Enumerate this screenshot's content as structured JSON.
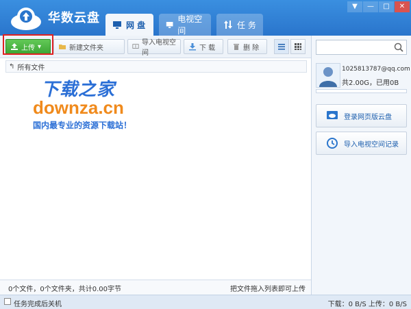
{
  "app": {
    "title": "华数云盘"
  },
  "tabs": [
    {
      "label": "网 盘",
      "active": true
    },
    {
      "label": "电视空间",
      "active": false
    },
    {
      "label": "任 务",
      "active": false
    }
  ],
  "window_buttons": {
    "menu": "▼",
    "minimize": "—",
    "maximize": "□",
    "close": "✕"
  },
  "toolbar": {
    "upload": "上传",
    "new_folder": "新建文件夹",
    "import_tv": "导入电视空间",
    "download": "下 载",
    "delete": "删 除"
  },
  "breadcrumb": {
    "label": "所有文件"
  },
  "watermark": {
    "line1": "下载之家",
    "line2": "downza.cn",
    "line3": "国内最专业的资源下载站！"
  },
  "status": {
    "summary": "0个文件，0个文件夹，共计0.00字节",
    "hint": "把文件拖入列表即可上传"
  },
  "search": {
    "placeholder": ""
  },
  "user": {
    "email": "1025813787@qq.com",
    "quota": "共2.00G，已用0B",
    "used_fraction": 0
  },
  "side_buttons": {
    "web_login": "登录网页版云盘",
    "import_tv_record": "导入电视空间记录"
  },
  "bottom": {
    "shutdown_label": "任务完成后关机",
    "speed": "下载：0 B/S  上传：0 B/S"
  },
  "colors": {
    "titlebar": "#2a75cc",
    "accent": "#1d5fae",
    "upload_green": "#3ea636",
    "highlight_red": "#e02020"
  }
}
